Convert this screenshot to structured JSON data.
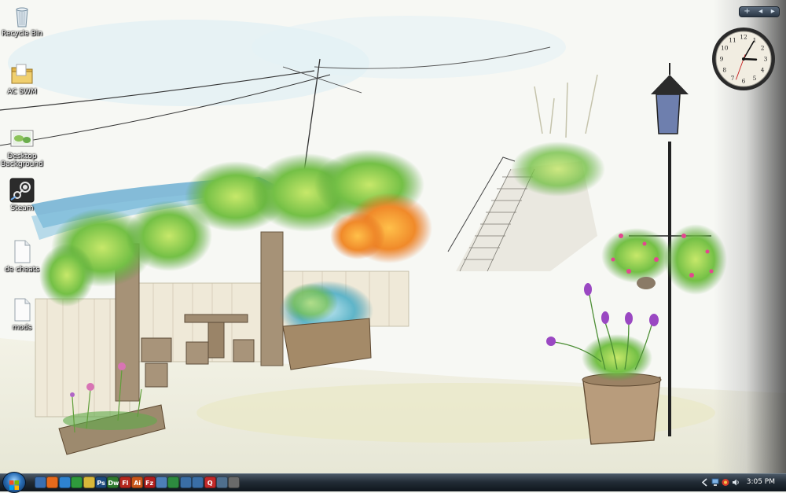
{
  "desktop": {
    "icons": [
      {
        "label": "Recycle Bin",
        "icon": "recycle-bin-icon"
      },
      {
        "label": "AC SWM",
        "icon": "folder-icon"
      },
      {
        "label": "Desktop Background",
        "icon": "image-file-icon"
      },
      {
        "label": "Steam",
        "icon": "steam-icon"
      },
      {
        "label": "de cheats",
        "icon": "text-file-icon"
      },
      {
        "label": "mods",
        "icon": "text-file-icon"
      }
    ]
  },
  "sidebar": {
    "add_glyph": "+",
    "prev_glyph": "◂",
    "next_glyph": "▸",
    "clock": {
      "hour": 3,
      "minute": 5,
      "numerals": [
        "12",
        "1",
        "2",
        "3",
        "4",
        "5",
        "6",
        "7",
        "8",
        "9",
        "10",
        "11"
      ]
    }
  },
  "taskbar": {
    "quick_launch": [
      {
        "icon": "show-desktop-icon",
        "color": "#3b6fb0",
        "text": ""
      },
      {
        "icon": "firefox-icon",
        "color": "#e66a1c",
        "text": ""
      },
      {
        "icon": "internet-explorer-icon",
        "color": "#2e83d0",
        "text": ""
      },
      {
        "icon": "media-player-icon",
        "color": "#2f9a3c",
        "text": ""
      },
      {
        "icon": "paint-icon",
        "color": "#d8b73a",
        "text": ""
      },
      {
        "icon": "photoshop-icon",
        "color": "#1d4a7e",
        "text": "Ps"
      },
      {
        "icon": "dreamweaver-icon",
        "color": "#2f7a2f",
        "text": "Dw"
      },
      {
        "icon": "flash-icon",
        "color": "#b5281e",
        "text": "Fl"
      },
      {
        "icon": "illustrator-icon",
        "color": "#c8561a",
        "text": "Ai"
      },
      {
        "icon": "filezilla-icon",
        "color": "#b11e1e",
        "text": "Fz"
      },
      {
        "icon": "scripting-icon",
        "color": "#4d7fb8",
        "text": ""
      },
      {
        "icon": "excel-icon",
        "color": "#2d8a3f",
        "text": ""
      },
      {
        "icon": "desktop-manager-icon",
        "color": "#3a6ea5",
        "text": ""
      },
      {
        "icon": "network-icon",
        "color": "#3a6ea5",
        "text": ""
      },
      {
        "icon": "quicktime-icon",
        "color": "#c22a2a",
        "text": "Q"
      },
      {
        "icon": "monitor-icon",
        "color": "#4f6f8e",
        "text": ""
      },
      {
        "icon": "media-icon",
        "color": "#6a6a6a",
        "text": ""
      }
    ],
    "tray": {
      "time": "3:05 PM",
      "icons": [
        "show-hidden-icon",
        "network-tray-icon",
        "security-tray-icon",
        "volume-icon"
      ]
    }
  }
}
